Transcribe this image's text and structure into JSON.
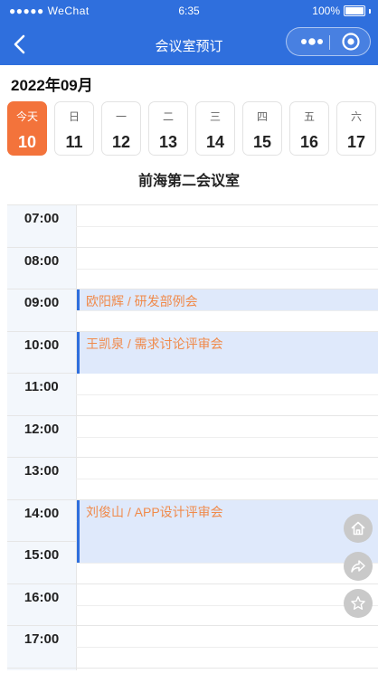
{
  "status_bar": {
    "carrier": "●●●●● WeChat",
    "time": "6:35",
    "battery": "100%"
  },
  "nav": {
    "title": "会议室预订",
    "back_icon": "chevron-left-icon",
    "more_icon": "more-dots-icon",
    "close_icon": "target-circle-icon"
  },
  "month_label": "2022年09月",
  "days": [
    {
      "weekday": "今天",
      "date": "10",
      "selected": true
    },
    {
      "weekday": "日",
      "date": "11"
    },
    {
      "weekday": "一",
      "date": "12"
    },
    {
      "weekday": "二",
      "date": "13"
    },
    {
      "weekday": "三",
      "date": "14"
    },
    {
      "weekday": "四",
      "date": "15"
    },
    {
      "weekday": "五",
      "date": "16"
    },
    {
      "weekday": "六",
      "date": "17"
    }
  ],
  "room_name": "前海第二会议室",
  "hours": [
    "07:00",
    "08:00",
    "09:00",
    "10:00",
    "11:00",
    "12:00",
    "13:00",
    "14:00",
    "15:00",
    "16:00",
    "17:00"
  ],
  "events": [
    {
      "label": "欧阳辉 / 研发部例会",
      "start": "09:00",
      "end": "09:30"
    },
    {
      "label": "王凯泉 / 需求讨论评审会",
      "start": "10:00",
      "end": "11:00"
    },
    {
      "label": "刘俊山 / APP设计评审会",
      "start": "14:00",
      "end": "15:30"
    }
  ],
  "floating_buttons": [
    "home-icon",
    "share-icon",
    "star-icon"
  ],
  "colors": {
    "header": "#2f6fdd",
    "today": "#f3733b",
    "event_bg": "#dfe9fb",
    "event_text": "#f08a4b"
  }
}
